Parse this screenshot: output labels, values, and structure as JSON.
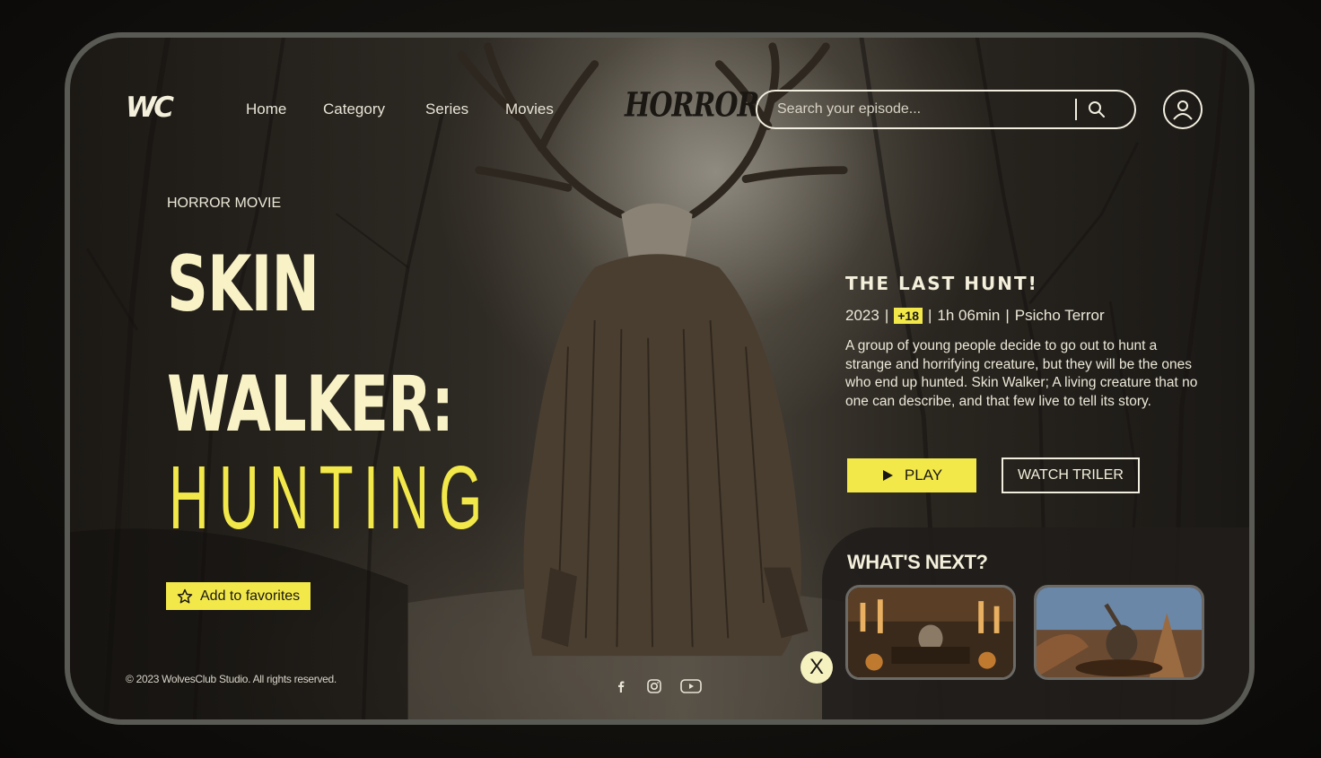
{
  "brand": {
    "logo_text": "WC",
    "genre_logo": "HORROR"
  },
  "nav": {
    "items": [
      "Home",
      "Category",
      "Series",
      "Movies"
    ]
  },
  "search": {
    "placeholder": "Search your episode..."
  },
  "hero": {
    "genre": "HORROR MOVIE",
    "title_line1": "SKIN",
    "title_line2": "WALKER:",
    "title_line3": "HUNTING",
    "favorites_label": "Add to favorites"
  },
  "details": {
    "title": "THE LAST HUNT!",
    "year": "2023",
    "rating": "+18",
    "duration": "1h 06min",
    "category": "Psicho Terror",
    "separator": "|",
    "description": "A group of young people decide to go out to hunt a strange and horrifying creature, but they will be the ones who end up hunted. Skin Walker; A living creature that no one can describe, and that few live to tell its story.",
    "play_label": "PLAY",
    "trailer_label": "WATCH TRILER"
  },
  "whats_next": {
    "title": "WHAT'S NEXT?"
  },
  "footer": {
    "copyright": "© 2023 WolvesClub Studio. All rights reserved."
  },
  "social": {
    "icons": [
      "facebook-icon",
      "instagram-icon",
      "youtube-icon"
    ]
  },
  "close": {
    "label": "X"
  },
  "colors": {
    "accent": "#f2e84a",
    "title_cream": "#f8f2c6",
    "text": "#ece8d8"
  }
}
